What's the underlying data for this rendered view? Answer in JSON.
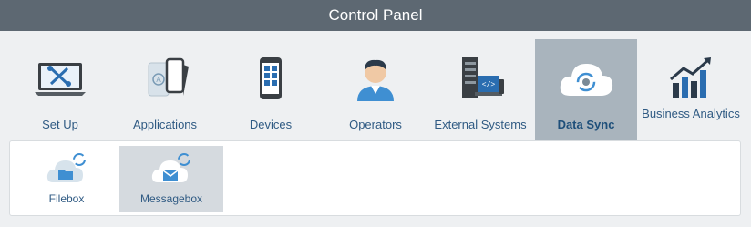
{
  "panel": {
    "title": "Control Panel"
  },
  "categories": [
    {
      "label": "Set Up",
      "icon": "laptop-tools-icon"
    },
    {
      "label": "Applications",
      "icon": "applications-icon"
    },
    {
      "label": "Devices",
      "icon": "device-icon"
    },
    {
      "label": "Operators",
      "icon": "operator-icon"
    },
    {
      "label": "External Systems",
      "icon": "server-icon"
    },
    {
      "label": "Data Sync",
      "icon": "cloud-sync-icon",
      "selected": true
    },
    {
      "label": "Business Analytics",
      "icon": "analytics-chart-icon"
    }
  ],
  "subitems": [
    {
      "label": "Filebox",
      "icon": "cloud-folder-icon"
    },
    {
      "label": "Messagebox",
      "icon": "cloud-message-icon",
      "selected": true
    }
  ],
  "colors": {
    "titlebar": "#5d6872",
    "selected_tile": "#a9b4bd",
    "label": "#2f5a83",
    "accent_blue": "#3f8fd2"
  }
}
